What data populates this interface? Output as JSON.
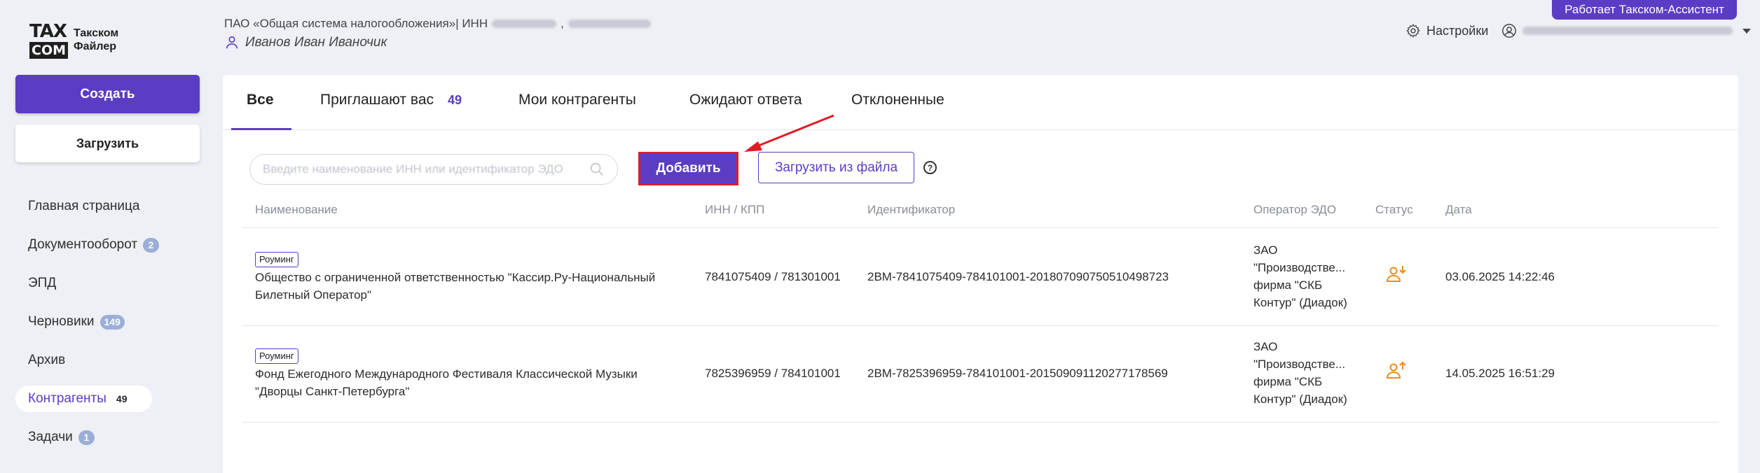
{
  "header": {
    "logo_top": "TAX",
    "logo_bottom": "COM",
    "logo_line1": "Такском",
    "logo_line2": "Файлер",
    "org_name": "ПАО «Общая система налогообложения»| ИНН",
    "org_sep": ",",
    "user_name": "Иванов Иван Иваночик",
    "assistant_label": "Работает Такском-Ассистент",
    "settings_label": "Настройки"
  },
  "sidebar": {
    "create_label": "Создать",
    "upload_label": "Загрузить",
    "items": [
      {
        "label": "Главная страница",
        "badge": ""
      },
      {
        "label": "Документооборот",
        "badge": "2"
      },
      {
        "label": "ЭПД",
        "badge": ""
      },
      {
        "label": "Черновики",
        "badge": "149"
      },
      {
        "label": "Архив",
        "badge": ""
      },
      {
        "label": "Контрагенты",
        "badge": "49"
      },
      {
        "label": "Задачи",
        "badge": "1"
      }
    ]
  },
  "tabs": [
    {
      "label": "Все"
    },
    {
      "label": "Приглашают вас",
      "count": "49"
    },
    {
      "label": "Мои контрагенты"
    },
    {
      "label": "Ожидают ответа"
    },
    {
      "label": "Отклоненные"
    }
  ],
  "toolbar": {
    "search_placeholder": "Введите наименование ИНН или идентификатор ЭДО",
    "add_label": "Добавить",
    "load_file_label": "Загрузить из файла",
    "help_label": "?"
  },
  "table": {
    "headers": [
      "Наименование",
      "ИНН / КПП",
      "Идентификатор",
      "Оператор ЭДО",
      "Статус",
      "Дата"
    ],
    "rows": [
      {
        "tag": "Роуминг",
        "name_line1": "Общество с ограниченной ответственностью \"Кассир.Ру-Национальный",
        "name_line2": "Билетный Оператор\"",
        "inn_kpp": "7841075409 / 781301001",
        "identifier": "2BM-7841075409-784101001-201807090750510498723",
        "operator_lines": [
          "ЗАО",
          "\"Производстве...",
          "фирма \"СКБ",
          "Контур\" (Диадок)"
        ],
        "status_icon": "incoming-invite-icon",
        "date": "03.06.2025 14:22:46"
      },
      {
        "tag": "Роуминг",
        "name_line1": "Фонд Ежегодного Международного Фестиваля Классической Музыки",
        "name_line2": "\"Дворцы Санкт-Петербурга\"",
        "inn_kpp": "7825396959 / 784101001",
        "identifier": "2BM-7825396959-784101001-201509091120277178569",
        "operator_lines": [
          "ЗАО",
          "\"Производстве...",
          "фирма \"СКБ",
          "Контур\" (Диадок)"
        ],
        "status_icon": "outgoing-invite-icon",
        "date": "14.05.2025 16:51:29"
      }
    ]
  },
  "colors": {
    "accent": "#5b3cc4",
    "highlight": "#e01b24",
    "status_icon": "#f08a1c",
    "badge": "#9aaed7"
  }
}
